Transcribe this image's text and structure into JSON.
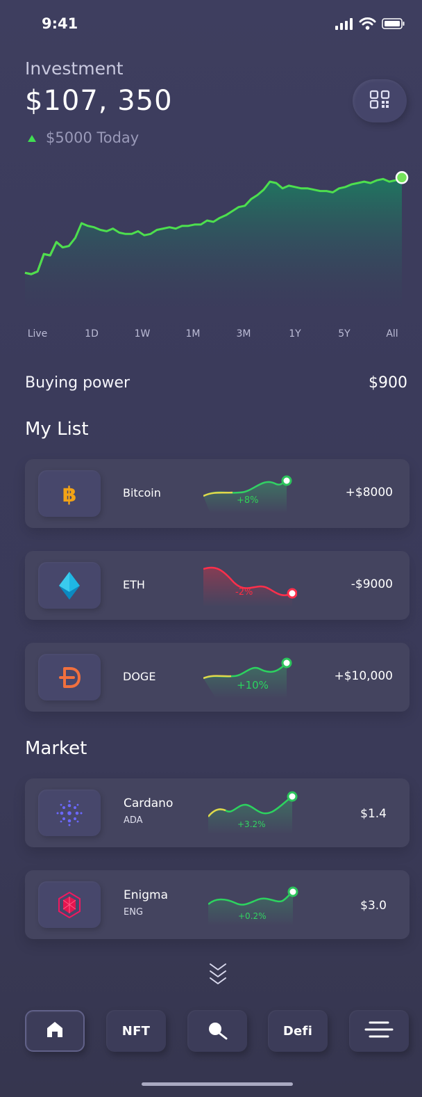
{
  "status_bar": {
    "time": "9:41",
    "icons": [
      "signal-icon",
      "wifi-icon",
      "battery-icon"
    ]
  },
  "header": {
    "eyebrow": "Investment",
    "balance": "$107, 350",
    "change": "$5000 Today",
    "change_icon": "up-triangle-icon",
    "qr_icon": "qr-code-icon"
  },
  "chart_data": {
    "type": "area",
    "title": "",
    "xlabel": "",
    "ylabel": "",
    "x": [
      1,
      2,
      3,
      4,
      5,
      6,
      7,
      8,
      9,
      10,
      11,
      12,
      13,
      14,
      15,
      16,
      17,
      18,
      19,
      20,
      21,
      22,
      23,
      24,
      25,
      26,
      27,
      28,
      29,
      30,
      31,
      32,
      33,
      34,
      35,
      36,
      37,
      38,
      39,
      40,
      41,
      42,
      43,
      44,
      45,
      46,
      47,
      48,
      49,
      50,
      51,
      52,
      53,
      54,
      55,
      56,
      57,
      58,
      59,
      60,
      61
    ],
    "values": [
      30,
      29,
      31,
      44,
      43,
      53,
      49,
      50,
      56,
      67,
      65,
      64,
      62,
      61,
      63,
      60,
      59,
      59,
      61,
      58,
      59,
      62,
      63,
      64,
      63,
      65,
      65,
      66,
      66,
      69,
      68,
      71,
      73,
      76,
      79,
      80,
      85,
      88,
      92,
      98,
      97,
      93,
      95,
      94,
      93,
      93,
      92,
      91,
      91,
      90,
      93,
      94,
      96,
      97,
      98,
      97,
      99,
      100,
      98,
      99,
      101
    ],
    "ylim": [
      0,
      110
    ],
    "grid": false,
    "series_color": "#4ddf4e",
    "fill_top_color": "#1d7a60",
    "fill_bottom_color": "#3c3c5c"
  },
  "ranges": [
    "Live",
    "1D",
    "1W",
    "1M",
    "3M",
    "1Y",
    "5Y",
    "All"
  ],
  "buying_power": {
    "label": "Buying power",
    "value": "$900"
  },
  "my_list": {
    "title": "My List",
    "items": [
      {
        "name": "Bitcoin",
        "value": "+$8000",
        "pct": "+8%",
        "trend": "up",
        "icon": "bitcoin-icon"
      },
      {
        "name": "ETH",
        "value": "-$9000",
        "pct": "-2%",
        "trend": "down",
        "icon": "ethereum-icon"
      },
      {
        "name": "DOGE",
        "value": "+$10,000",
        "pct": "+10%",
        "trend": "up",
        "icon": "dogecoin-icon"
      }
    ]
  },
  "market": {
    "title": "Market",
    "items": [
      {
        "name": "Cardano",
        "symbol": "ADA",
        "price": "$1.4",
        "pct": "+3.2%",
        "trend": "up",
        "icon": "cardano-icon"
      },
      {
        "name": "Enigma",
        "symbol": "ENG",
        "price": "$3.0",
        "pct": "+0.2%",
        "trend": "up",
        "icon": "enigma-icon"
      }
    ]
  },
  "scroll_indicator_icon": "chevrons-down-icon",
  "nav": {
    "nft": "NFT",
    "defi": "Defi",
    "home_icon": "home-icon",
    "search_icon": "search-icon",
    "menu_icon": "menu-icon"
  },
  "colors": {
    "accent_green": "#40dd52",
    "accent_red": "#ff3346",
    "surface": "#44445f",
    "background": "#3b3b5b"
  }
}
